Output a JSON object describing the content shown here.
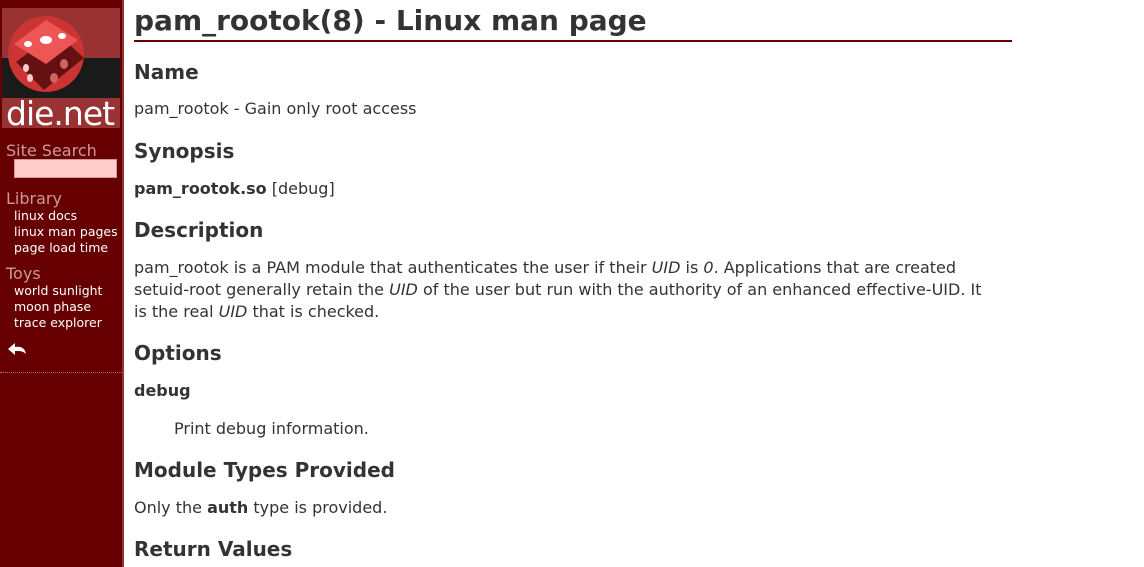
{
  "sidebar": {
    "logo_text": "die.net",
    "search_label": "Site Search",
    "search_value": "",
    "library_label": "Library",
    "library_links": [
      "linux docs",
      "linux man pages",
      "page load time"
    ],
    "toys_label": "Toys",
    "toys_links": [
      "world sunlight",
      "moon phase",
      "trace explorer"
    ]
  },
  "page": {
    "title": "pam_rootok(8) - Linux man page",
    "sections": {
      "name_heading": "Name",
      "name_text": "pam_rootok - Gain only root access",
      "synopsis_heading": "Synopsis",
      "synopsis_cmd": "pam_rootok.so",
      "synopsis_args": " [debug]",
      "description_heading": "Description",
      "description_parts": [
        "pam_rootok is a PAM module that authenticates the user if their ",
        "UID",
        " is ",
        "0",
        ". Applications that are created setuid-root generally retain the ",
        "UID",
        " of the user but run with the authority of an enhanced effective-UID. It is the real ",
        "UID",
        " that is checked."
      ],
      "options_heading": "Options",
      "option_name": "debug",
      "option_desc": "Print debug information.",
      "module_types_heading": "Module Types Provided",
      "module_types_parts": [
        "Only the ",
        "auth",
        " type is provided."
      ],
      "return_values_heading": "Return Values"
    }
  },
  "colors": {
    "sidebar_bg": "#660000",
    "heading_rule": "#660000",
    "text": "#333333",
    "search_bg": "#ffcccc"
  }
}
